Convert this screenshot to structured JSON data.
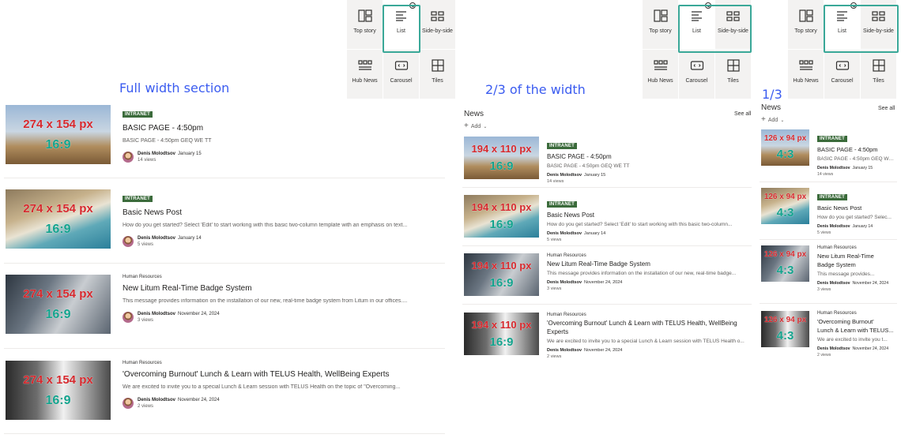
{
  "pickers": [
    {
      "top_row": [
        {
          "label": "Top story",
          "icon": "top-story-icon",
          "selected": false
        },
        {
          "label": "List",
          "icon": "list-icon",
          "selected": true
        },
        {
          "label": "Side-by-side",
          "icon": "side-by-side-icon",
          "selected": false
        }
      ],
      "bottom_row": [
        {
          "label": "Hub News",
          "icon": "hub-news-icon"
        },
        {
          "label": "Carousel",
          "icon": "carousel-icon"
        },
        {
          "label": "Tiles",
          "icon": "tiles-icon"
        }
      ]
    },
    {
      "top_row": [
        {
          "label": "Top story",
          "icon": "top-story-icon",
          "selected": false
        },
        {
          "label": "List",
          "icon": "list-icon",
          "selected": true
        },
        {
          "label": "Side-by-side",
          "icon": "side-by-side-icon",
          "selected": false
        }
      ],
      "bottom_row": [
        {
          "label": "Hub News",
          "icon": "hub-news-icon"
        },
        {
          "label": "Carousel",
          "icon": "carousel-icon"
        },
        {
          "label": "Tiles",
          "icon": "tiles-icon"
        }
      ]
    },
    {
      "top_row": [
        {
          "label": "Top story",
          "icon": "top-story-icon",
          "selected": false
        },
        {
          "label": "List",
          "icon": "list-icon",
          "selected": true
        },
        {
          "label": "Side-by-side",
          "icon": "side-by-side-icon",
          "selected": false
        }
      ],
      "bottom_row": [
        {
          "label": "Hub News",
          "icon": "hub-news-icon"
        },
        {
          "label": "Carousel",
          "icon": "carousel-icon"
        },
        {
          "label": "Tiles",
          "icon": "tiles-icon"
        }
      ]
    }
  ],
  "annotations": {
    "full": "Full width section",
    "two_thirds": "2/3 of the width",
    "one_third": "1/3"
  },
  "colors": {
    "annotation": "#3b5cf0",
    "highlight": "#3aa898",
    "tag_bg": "#3b6b3b",
    "size_label": "#d6282d",
    "ratio_label": "#13a38d"
  },
  "news_header": {
    "title": "News",
    "see_all": "See all",
    "add": "Add"
  },
  "overlays": {
    "full": {
      "size": "274 x 154 px",
      "ratio": "16:9"
    },
    "two_thirds": {
      "size": "194 x 110 px",
      "ratio": "16:9"
    },
    "one_third": {
      "size": "126 x 94 px",
      "ratio": "4:3"
    }
  },
  "posts": [
    {
      "category": "INTRANET",
      "category_is_tag": true,
      "title": "BASIC PAGE - 4:50pm",
      "description": "BASIC PAGE - 4:50pm GEQ WE TT",
      "description_short": "BASIC PAGE - 4:50pm GEQ WE TT",
      "description_narrow": "BASIC PAGE - 4:50pm GEQ WE TT",
      "author": "Denis Molodtsov",
      "date": "January 15",
      "views": "14 views",
      "image": "desert"
    },
    {
      "category": "INTRANET",
      "category_is_tag": true,
      "title": "Basic News Post",
      "description": "How do you get started? Select 'Edit' to start working with this basic two-column template with an emphasis on text...",
      "description_short": "How do you get started? Select 'Edit' to start working with this basic two-column...",
      "description_narrow": "How do you get started? Selec...",
      "author": "Denis Molodtsov",
      "date": "January 14",
      "views": "5 views",
      "image": "beach"
    },
    {
      "category": "Human Resources",
      "category_is_tag": false,
      "title": "New Litum Real-Time Badge System",
      "description": "This message provides information on the installation of our new, real-time badge system from Litum in our offices....",
      "description_short": "This message provides information on the installation of our new, real-time badge...",
      "description_narrow": "This message provides...",
      "title_narrow_1": "New Litum Real-Time",
      "title_narrow_2": "Badge System",
      "author": "Denis Molodtsov",
      "date": "November 24, 2024",
      "views": "3 views",
      "image": "office"
    },
    {
      "category": "Human Resources",
      "category_is_tag": false,
      "title": "'Overcoming Burnout' Lunch & Learn with TELUS Health, WellBeing Experts",
      "title_mid_1": "'Overcoming Burnout' Lunch & Learn with TELUS Health, WellBeing",
      "title_mid_2": "Experts",
      "title_narrow_1": "'Overcoming Burnout'",
      "title_narrow_2": "Lunch & Learn with TELUS...",
      "description": "We are excited to invite you to a special Lunch & Learn session with TELUS Health on the topic of \"Overcoming...",
      "description_short": "We are excited to invite you to a special Lunch & Learn session with TELUS Health o...",
      "description_narrow": "We are excited to invite you t...",
      "author": "Denis Molodtsov",
      "date": "November 24, 2024",
      "views": "2 views",
      "image": "people"
    }
  ]
}
